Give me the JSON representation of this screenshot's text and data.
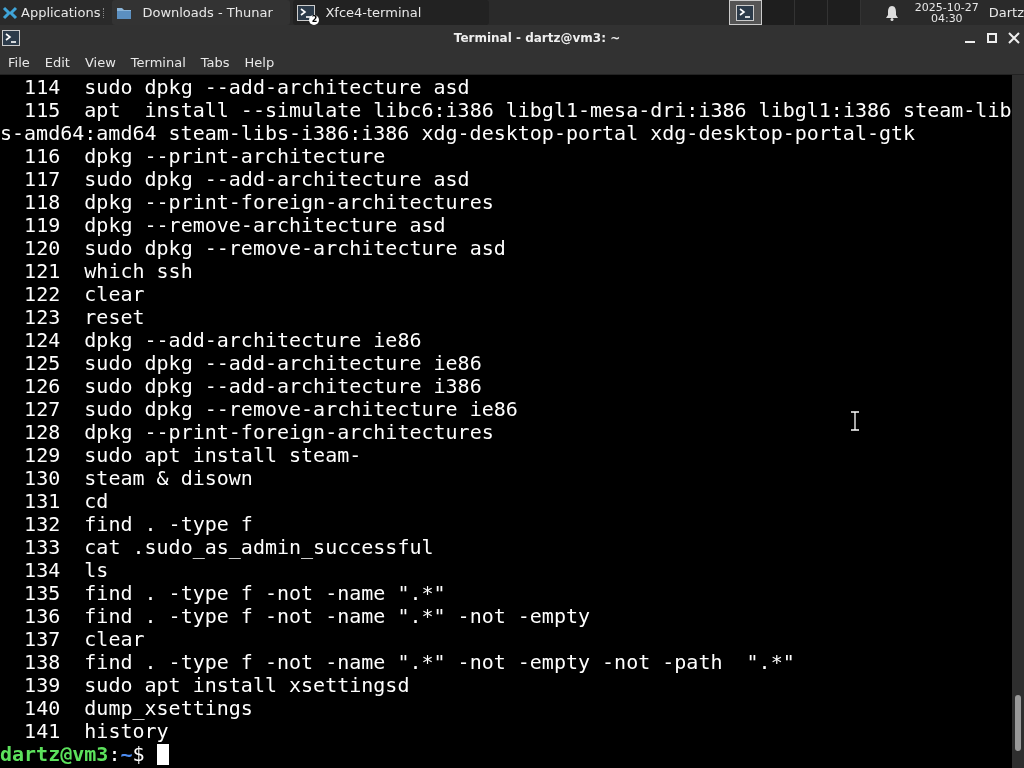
{
  "panel": {
    "apps_menu": "Applications",
    "tasks": [
      {
        "label": "Downloads - Thunar",
        "kind": "folder",
        "selected": false
      },
      {
        "label": "Xfce4-terminal",
        "kind": "terminal",
        "selected": true,
        "badge": "2"
      }
    ],
    "clock": {
      "date": "2025-10-27",
      "time": "04:30"
    },
    "user": "Dartz"
  },
  "window": {
    "title": "Terminal - dartz@vm3: ~"
  },
  "menu": [
    "File",
    "Edit",
    "View",
    "Terminal",
    "Tabs",
    "Help"
  ],
  "history": [
    {
      "number": "114",
      "command": "sudo dpkg --add-architecture asd"
    },
    {
      "number": "115",
      "command": "apt  install --simulate libc6:i386 libgl1-mesa-dri:i386 libgl1:i386 steam-libs-amd64:amd64 steam-libs-i386:i386 xdg-desktop-portal xdg-desktop-portal-gtk"
    },
    {
      "number": "116",
      "command": "dpkg --print-architecture"
    },
    {
      "number": "117",
      "command": "sudo dpkg --add-architecture asd"
    },
    {
      "number": "118",
      "command": "dpkg --print-foreign-architectures"
    },
    {
      "number": "119",
      "command": "dpkg --remove-architecture asd"
    },
    {
      "number": "120",
      "command": "sudo dpkg --remove-architecture asd"
    },
    {
      "number": "121",
      "command": "which ssh"
    },
    {
      "number": "122",
      "command": "clear"
    },
    {
      "number": "123",
      "command": "reset"
    },
    {
      "number": "124",
      "command": "dpkg --add-architecture ie86"
    },
    {
      "number": "125",
      "command": "sudo dpkg --add-architecture ie86"
    },
    {
      "number": "126",
      "command": "sudo dpkg --add-architecture i386"
    },
    {
      "number": "127",
      "command": "sudo dpkg --remove-architecture ie86"
    },
    {
      "number": "128",
      "command": "dpkg --print-foreign-architectures"
    },
    {
      "number": "129",
      "command": "sudo apt install steam-"
    },
    {
      "number": "130",
      "command": "steam & disown"
    },
    {
      "number": "131",
      "command": "cd"
    },
    {
      "number": "132",
      "command": "find . -type f"
    },
    {
      "number": "133",
      "command": "cat .sudo_as_admin_successful"
    },
    {
      "number": "134",
      "command": "ls"
    },
    {
      "number": "135",
      "command": "find . -type f -not -name \".*\""
    },
    {
      "number": "136",
      "command": "find . -type f -not -name \".*\" -not -empty"
    },
    {
      "number": "137",
      "command": "clear"
    },
    {
      "number": "138",
      "command": "find . -type f -not -name \".*\" -not -empty -not -path  \".*\""
    },
    {
      "number": "139",
      "command": "sudo apt install xsettingsd"
    },
    {
      "number": "140",
      "command": "dump_xsettings"
    },
    {
      "number": "141",
      "command": "history"
    }
  ],
  "prompt": {
    "user_host": "dartz@vm3",
    "separator": ":",
    "path": "~",
    "symbol": "$"
  }
}
